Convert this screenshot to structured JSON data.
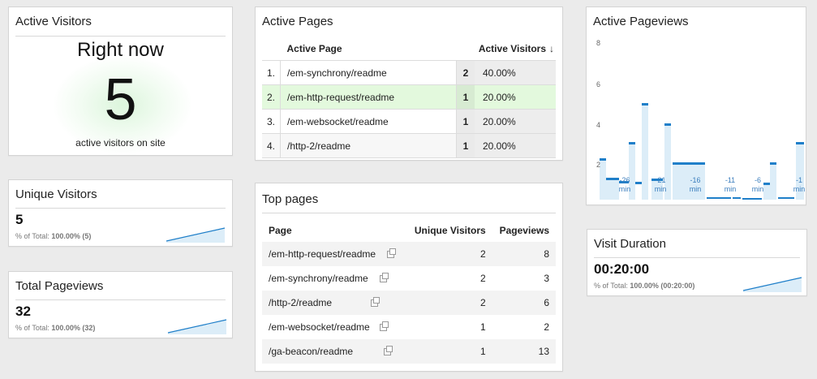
{
  "active_visitors": {
    "title": "Active Visitors",
    "right_now": "Right now",
    "count": "5",
    "caption": "active visitors on site"
  },
  "unique_visitors": {
    "title": "Unique Visitors",
    "value": "5",
    "sub_label": "% of Total:",
    "sub_value": "100.00% (5)"
  },
  "total_pageviews": {
    "title": "Total Pageviews",
    "value": "32",
    "sub_label": "% of Total:",
    "sub_value": "100.00% (32)"
  },
  "active_pages": {
    "title": "Active Pages",
    "col_page": "Active Page",
    "col_visitors": "Active Visitors",
    "sort_icon": "arrow-down-icon",
    "rows": [
      {
        "num": "1.",
        "page": "/em-synchrony/readme",
        "count": "2",
        "pct": "40.00%"
      },
      {
        "num": "2.",
        "page": "/em-http-request/readme",
        "count": "1",
        "pct": "20.00%"
      },
      {
        "num": "3.",
        "page": "/em-websocket/readme",
        "count": "1",
        "pct": "20.00%"
      },
      {
        "num": "4.",
        "page": "/http-2/readme",
        "count": "1",
        "pct": "20.00%"
      }
    ]
  },
  "top_pages": {
    "title": "Top pages",
    "col_page": "Page",
    "col_unique": "Unique Visitors",
    "col_pageviews": "Pageviews",
    "rows": [
      {
        "page": "/em-http-request/readme",
        "unique": "2",
        "pageviews": "8"
      },
      {
        "page": "/em-synchrony/readme",
        "unique": "2",
        "pageviews": "3"
      },
      {
        "page": "/http-2/readme",
        "unique": "2",
        "pageviews": "6"
      },
      {
        "page": "/em-websocket/readme",
        "unique": "1",
        "pageviews": "2"
      },
      {
        "page": "/ga-beacon/readme",
        "unique": "1",
        "pageviews": "13"
      }
    ]
  },
  "active_pageviews": {
    "title": "Active Pageviews",
    "y_ticks": [
      "8",
      "6",
      "4",
      "2"
    ],
    "x_ticks": [
      "-26",
      "-21",
      "-16",
      "-11",
      "-6",
      "-1"
    ],
    "x_unit": "min"
  },
  "visit_duration": {
    "title": "Visit Duration",
    "value": "00:20:00",
    "sub_label": "% of Total:",
    "sub_value": "100.00% (00:20:00)"
  },
  "colors": {
    "accent": "#1f7fc9",
    "bar_fill": "#dcedf8",
    "highlight_row": "#e3f9dd"
  }
}
